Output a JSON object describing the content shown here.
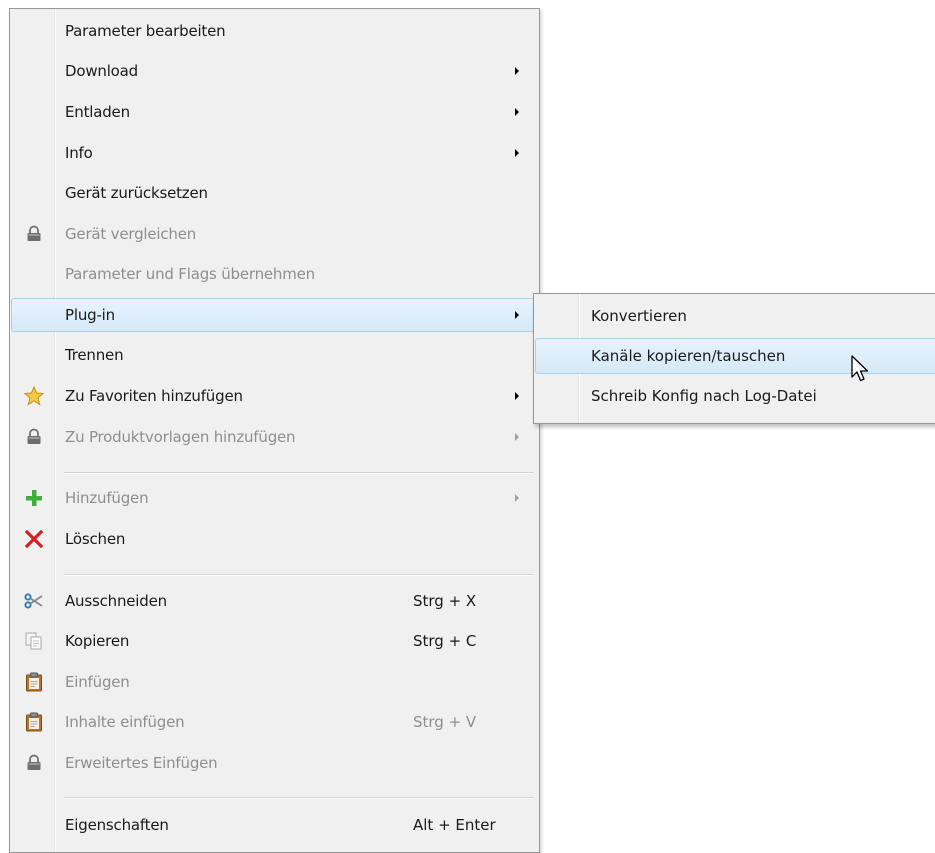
{
  "context_menu": {
    "items": [
      {
        "label": "Parameter bearbeiten",
        "shortcut": "",
        "has_submenu": false,
        "disabled": false,
        "icon": ""
      },
      {
        "label": "Download",
        "shortcut": "",
        "has_submenu": true,
        "disabled": false,
        "icon": ""
      },
      {
        "label": "Entladen",
        "shortcut": "",
        "has_submenu": true,
        "disabled": false,
        "icon": ""
      },
      {
        "label": "Info",
        "shortcut": "",
        "has_submenu": true,
        "disabled": false,
        "icon": ""
      },
      {
        "label": "Gerät zurücksetzen",
        "shortcut": "",
        "has_submenu": false,
        "disabled": false,
        "icon": ""
      },
      {
        "label": "Gerät vergleichen",
        "shortcut": "",
        "has_submenu": false,
        "disabled": true,
        "icon": "lock-icon"
      },
      {
        "label": "Parameter und Flags übernehmen",
        "shortcut": "",
        "has_submenu": false,
        "disabled": true,
        "icon": ""
      },
      {
        "label": "Plug-in",
        "shortcut": "",
        "has_submenu": true,
        "disabled": false,
        "icon": "",
        "highlighted": true
      },
      {
        "label": "Trennen",
        "shortcut": "",
        "has_submenu": false,
        "disabled": false,
        "icon": ""
      },
      {
        "label": "Zu Favoriten hinzufügen",
        "shortcut": "",
        "has_submenu": true,
        "disabled": false,
        "icon": "star-icon"
      },
      {
        "label": "Zu Produktvorlagen hinzufügen",
        "shortcut": "",
        "has_submenu": true,
        "disabled": true,
        "icon": "lock-icon"
      },
      {
        "label": "Hinzufügen",
        "shortcut": "",
        "has_submenu": true,
        "disabled": true,
        "icon": "plus-icon"
      },
      {
        "label": "Löschen",
        "shortcut": "",
        "has_submenu": false,
        "disabled": false,
        "icon": "delete-x-icon"
      },
      {
        "label": "Ausschneiden",
        "shortcut": "Strg + X",
        "has_submenu": false,
        "disabled": false,
        "icon": "scissors-icon"
      },
      {
        "label": "Kopieren",
        "shortcut": "Strg + C",
        "has_submenu": false,
        "disabled": false,
        "icon": "copy-icon"
      },
      {
        "label": "Einfügen",
        "shortcut": "",
        "has_submenu": false,
        "disabled": true,
        "icon": "clipboard-icon"
      },
      {
        "label": "Inhalte einfügen",
        "shortcut": "Strg + V",
        "has_submenu": false,
        "disabled": true,
        "icon": "clipboard-icon"
      },
      {
        "label": "Erweitertes Einfügen",
        "shortcut": "",
        "has_submenu": false,
        "disabled": true,
        "icon": "lock-icon"
      },
      {
        "label": "Eigenschaften",
        "shortcut": "Alt + Enter",
        "has_submenu": false,
        "disabled": false,
        "icon": ""
      }
    ]
  },
  "plugin_submenu": {
    "items": [
      {
        "label": "Konvertieren",
        "highlighted": false
      },
      {
        "label": "Kanäle kopieren/tauschen",
        "highlighted": true
      },
      {
        "label": "Schreib Konfig nach Log-Datei",
        "highlighted": false
      }
    ]
  },
  "colors": {
    "menu_background": "#f0f0f0",
    "highlight_border": "#a8d2ef",
    "highlight_fill": "#dcecf9",
    "disabled_text": "#8e8e8e"
  }
}
